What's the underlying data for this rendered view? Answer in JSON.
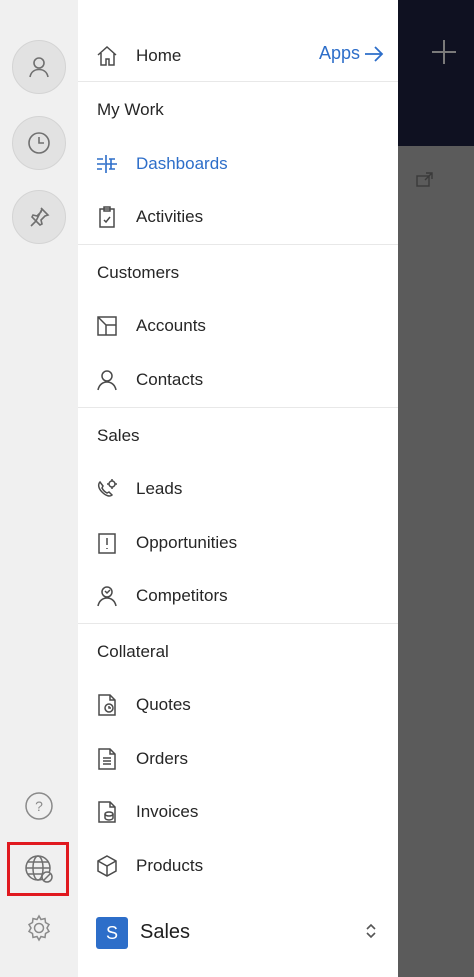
{
  "colors": {
    "accent": "#2d6ec9",
    "highlight_box": "#e0191f",
    "rail_bg": "#f0f0f0",
    "overlay_header": "#0f1121"
  },
  "rail": {
    "buttons": [
      {
        "icon": "profile-icon"
      },
      {
        "icon": "clock-icon"
      },
      {
        "icon": "pin-icon"
      }
    ],
    "bottom": [
      {
        "icon": "help-icon",
        "glyph": "?"
      },
      {
        "icon": "globe-icon"
      },
      {
        "icon": "settings-icon"
      }
    ]
  },
  "nav": {
    "home_label": "Home",
    "apps_label": "Apps",
    "sections": [
      {
        "title": "My Work",
        "items": [
          {
            "label": "Dashboards",
            "icon": "dashboard-icon",
            "active": true
          },
          {
            "label": "Activities",
            "icon": "clipboard-icon"
          }
        ]
      },
      {
        "title": "Customers",
        "items": [
          {
            "label": "Accounts",
            "icon": "account-icon"
          },
          {
            "label": "Contacts",
            "icon": "person-icon"
          }
        ]
      },
      {
        "title": "Sales",
        "items": [
          {
            "label": "Leads",
            "icon": "phone-icon"
          },
          {
            "label": "Opportunities",
            "icon": "opportunity-icon"
          },
          {
            "label": "Competitors",
            "icon": "competitor-icon"
          }
        ]
      },
      {
        "title": "Collateral",
        "items": [
          {
            "label": "Quotes",
            "icon": "quote-icon"
          },
          {
            "label": "Orders",
            "icon": "order-icon"
          },
          {
            "label": "Invoices",
            "icon": "invoice-icon"
          },
          {
            "label": "Products",
            "icon": "box-icon"
          }
        ]
      }
    ],
    "footer": {
      "app_letter": "S",
      "app_name": "Sales"
    }
  }
}
